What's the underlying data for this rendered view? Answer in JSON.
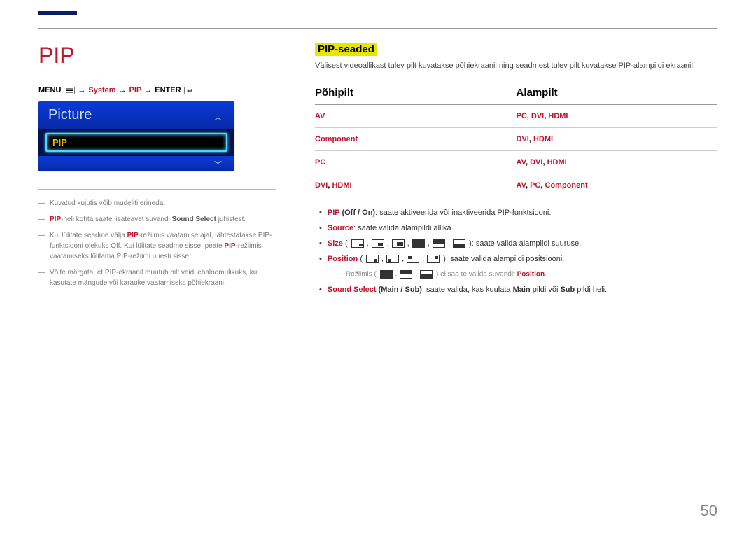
{
  "page_number": "50",
  "heading": "PIP",
  "breadcrumb": {
    "menu": "MENU",
    "system": "System",
    "pip": "PIP",
    "enter": "ENTER"
  },
  "menu_preview": {
    "title": "Picture",
    "selected": "PIP"
  },
  "left_notes": {
    "n1": "Kuvatud kujutis võib mudeliti erineda.",
    "n2_pre": "PIP",
    "n2_mid": "-heli kohta saate lisateavet suvandi ",
    "n2_k": "Sound Select",
    "n2_post": " juhistest.",
    "n3_a": "Kui lülitate seadme välja ",
    "n3_b": "PIP",
    "n3_c": "-režiimis vaatamise ajal, lähtestatakse PIP-funktsiooni olekuks Off. Kui lülitate seadme sisse, peate ",
    "n3_d": "PIP",
    "n3_e": "-režiimis vaatamiseks lülitama PIP-režiimi uuesti sisse.",
    "n4": "Võite märgata, et PIP-ekraanil muutub pilt veidi ebaloomulikuks, kui kasutate mängude või karaoke vaatamiseks põhiekraani."
  },
  "section_title": "PIP-seaded",
  "section_desc": "Välisest videoallikast tulev pilt kuvatakse põhiekraanil ning seadmest tulev pilt kuvatakse PIP-alampildi ekraanil.",
  "table": {
    "head_main": "Põhipilt",
    "head_sub": "Alampilt",
    "rows": [
      {
        "main": "AV",
        "sub_a": "PC",
        "sub_b": "DVI",
        "sub_c": "HDMI"
      },
      {
        "main": "Component",
        "sub_a": "DVI",
        "sub_b": "HDMI",
        "sub_c": ""
      },
      {
        "main": "PC",
        "sub_a": "AV",
        "sub_b": "DVI",
        "sub_c": "HDMI"
      },
      {
        "main_a": "DVI",
        "main_b": "HDMI",
        "sub_a": "AV",
        "sub_b": "PC",
        "sub_c": "Component"
      }
    ]
  },
  "bullets": {
    "b1_k": "PIP",
    "b1_paren": " (Off / On)",
    "b1_text": ": saate aktiveerida või inaktiveerida PIP-funktsiooni.",
    "b2_k": "Source",
    "b2_text": ": saate valida alampildi allika.",
    "b3_k": "Size",
    "b3_text": ": saate valida alampildi suuruse.",
    "b4_k": "Position",
    "b4_text": ": saate valida alampildi positsiooni.",
    "b4_sub_a": "Režiimis (",
    "b4_sub_b": ") ei saa te valida suvandit ",
    "b4_sub_k": "Position",
    "b4_sub_c": ".",
    "b5_k": "Sound Select",
    "b5_paren": " (Main / Sub)",
    "b5_text_a": ": saate valida, kas kuulata ",
    "b5_main": "Main",
    "b5_text_b": " pildi või ",
    "b5_sub": "Sub",
    "b5_text_c": " pildi heli."
  }
}
